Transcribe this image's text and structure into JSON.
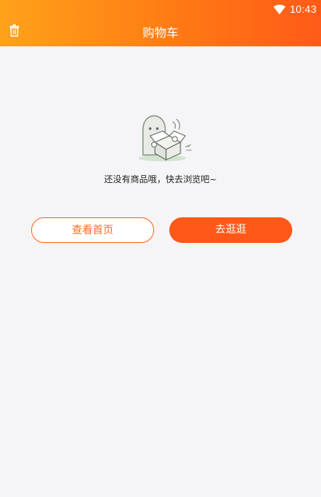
{
  "status_bar": {
    "time": "10:43",
    "wifi_icon": "wifi-icon"
  },
  "header": {
    "title": "购物车",
    "left_icon": "trash-icon"
  },
  "empty_state": {
    "illustration": "ghost-with-open-box",
    "message": "还没有商品哦，快去浏览吧~"
  },
  "actions": {
    "view_home_label": "查看首页",
    "go_shopping_label": "去逛逛"
  },
  "colors": {
    "header_gradient_start": "#ffa21a",
    "header_gradient_end": "#ff5a18",
    "accent": "#ff5818",
    "background": "#f5f5f7"
  }
}
